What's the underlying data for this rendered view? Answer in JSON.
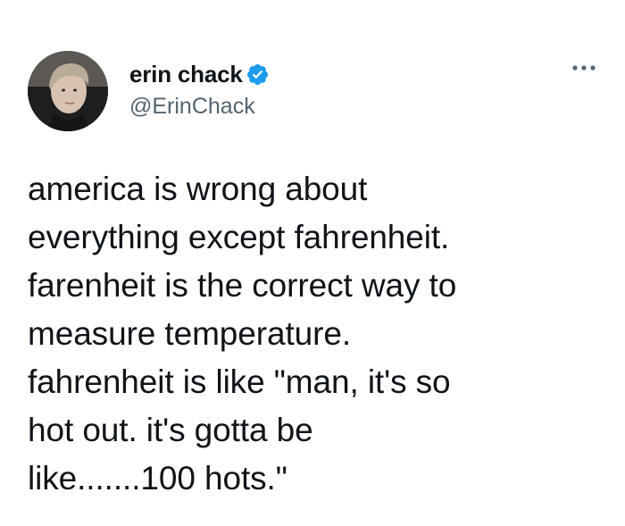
{
  "tweet": {
    "author": {
      "display_name": "erin chack",
      "handle": "@ErinChack",
      "verified": true,
      "avatar_icon": "profile-photo"
    },
    "more_icon": "ellipsis-icon",
    "text": "america is wrong about\neverything except fahrenheit.\nfarenheit is the correct way to\nmeasure temperature.\nfahrenheit is like \"man, it's so\nhot out. it's gotta be\nlike.......100 hots.\""
  },
  "colors": {
    "text": "#0f1419",
    "secondary_text": "#536471",
    "verified_blue": "#1d9bf0",
    "background": "#ffffff"
  }
}
